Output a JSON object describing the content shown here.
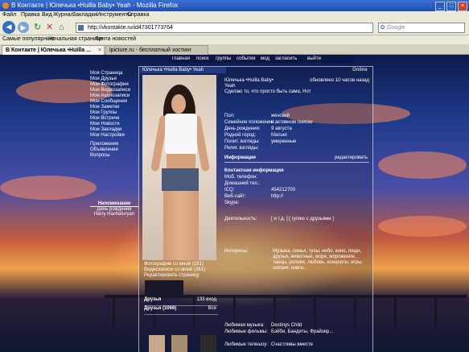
{
  "window": {
    "title": "В Контакте | Юлечька •Huilla Baby• Yeah - Mozilla Firefox",
    "controls": [
      "_",
      "□",
      "×"
    ]
  },
  "menu": [
    "Файл",
    "Правка",
    "Вид",
    "Журнал",
    "Закладки",
    "Инструменты",
    "Справка"
  ],
  "nav": {
    "url": "http://vkontakte.ru/id47301773764",
    "search_engine": "Google",
    "search_placeholder": "Google"
  },
  "bookmarks": [
    "Самые популярные",
    "Начальная страница",
    "Лента новостей"
  ],
  "tabs": [
    {
      "label": "В Контакте | Юлечька •Huilla ...",
      "active": true
    },
    {
      "label": "ipicture.ru - бесплатный хостинг фот...",
      "active": false
    }
  ],
  "site_nav": [
    "главная",
    "поиск",
    "группы",
    "события",
    "мод",
    "загласить",
    "выйти"
  ],
  "online_label": "Online",
  "profile_name": "Юлечька •Huilla Baby• Yeah",
  "sidebar": {
    "items": [
      "Моя Страница",
      "Мои Друзья",
      "Мои Фотографии",
      "Мои Видеозаписи",
      "Мои Аудиозаписи",
      "Мои Сообщения",
      "Мои Заметки",
      "Мои Группы",
      "Мои Встречи",
      "Мои Новости",
      "Мои Закладки",
      "Мои Настройки",
      "Приложения",
      "Объявления",
      "Вопросы"
    ],
    "reminder_title": "Напоминание",
    "reminder_text": "День рождения",
    "reminder_name": "Harry Hachaturyan"
  },
  "status": {
    "name_line": "Юлечька •Huilla Baby•",
    "edit_link": "Yeah",
    "text": "Сделаю то, что просто быть сама, Нот",
    "updated": "обновлено 10 часов назад"
  },
  "basic_info": [
    {
      "k": "Пол:",
      "v": "женский"
    },
    {
      "k": "Семейное положение:",
      "v": "в активном поиске"
    },
    {
      "k": "День рождения:",
      "v": "9 августа"
    },
    {
      "k": "Родной город:",
      "v": "Manuel"
    },
    {
      "k": "Полит. взгляды:",
      "v": "умеренные"
    },
    {
      "k": "Религ. взгляды:",
      "v": ""
    }
  ],
  "section_info": {
    "title": "Информация",
    "edit": "редактировать"
  },
  "contacts_header": "Контактная информация",
  "contacts": [
    {
      "k": "Моб. телефон:",
      "v": ""
    },
    {
      "k": "Домашний тел.:",
      "v": ""
    },
    {
      "k": "ICQ:",
      "v": "454212700"
    },
    {
      "k": "Веб-сайт:",
      "v": "http://"
    },
    {
      "k": "Skype:",
      "v": ""
    }
  ],
  "personal": [
    {
      "k": "Деятельность:",
      "v": "[ и т.д. ] [ гуляю с друзьями ]"
    },
    {
      "k": "Интересы:",
      "v": "Музыка, семья, тусы, небо, кино, люди, друзья, животные, море, мороженое, танцы, ролики, любовь, концерты, игры, шопинг, книги..."
    }
  ],
  "photo_links": [
    "Фотографии со мной (181)",
    "Видеозаписи со мной (261)",
    "Редактировать страницу"
  ],
  "friends": {
    "title": "Друзья",
    "online_title": "Друзья (1066)",
    "all": "Все",
    "online_count": "133 вход"
  },
  "music": {
    "k": "Любимая музыка:",
    "v": "Destinys Child"
  },
  "films": {
    "k": "Любимые фильмы:",
    "v": "Бэйби, Бандиты, Фрайзер..."
  },
  "games": {
    "k": "Любимые телешоу:",
    "v": "Счастливы вместе"
  }
}
